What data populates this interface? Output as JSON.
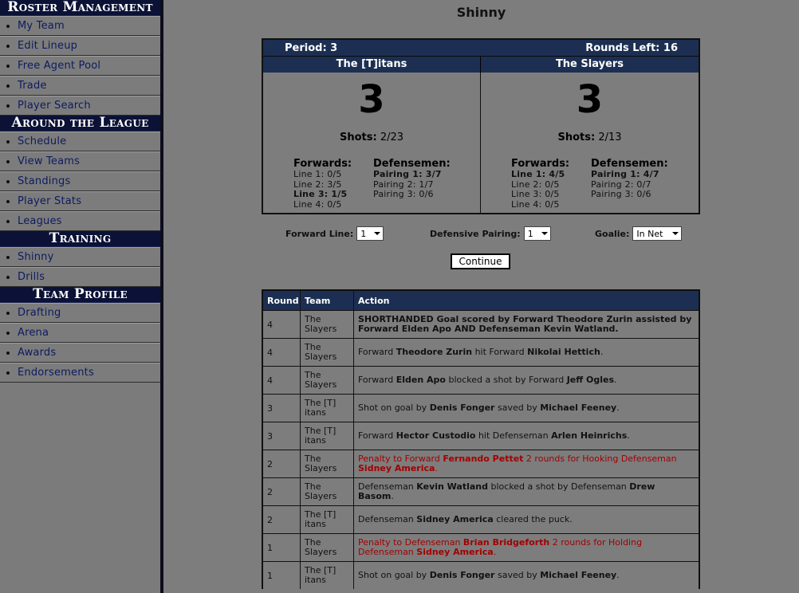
{
  "sidebar": {
    "sections": [
      {
        "title": "Roster Management",
        "items": [
          "My Team",
          "Edit Lineup",
          "Free Agent Pool",
          "Trade",
          "Player Search"
        ]
      },
      {
        "title": "Around the League",
        "items": [
          "Schedule",
          "View Teams",
          "Standings",
          "Player Stats",
          "Leagues"
        ]
      },
      {
        "title": "Training",
        "items": [
          "Shinny",
          "Drills"
        ]
      },
      {
        "title": "Team Profile",
        "items": [
          "Drafting",
          "Arena",
          "Awards",
          "Endorsements"
        ]
      }
    ]
  },
  "page": {
    "title": "Shinny"
  },
  "game": {
    "period_label": "Period: 3",
    "rounds_left_label": "Rounds Left: 16",
    "home": {
      "name": "The [T]itans",
      "score": "3",
      "shots_label": "Shots:",
      "shots_value": "2/23",
      "forwards_title": "Forwards:",
      "forwards": [
        {
          "text": "Line 1: 0/5",
          "bold": false
        },
        {
          "text": "Line 2: 3/5",
          "bold": false
        },
        {
          "text": "Line 3: 1/5",
          "bold": true
        },
        {
          "text": "Line 4: 0/5",
          "bold": false
        }
      ],
      "defense_title": "Defensemen:",
      "defense": [
        {
          "text": "Pairing 1: 3/7",
          "bold": true
        },
        {
          "text": "Pairing 2: 1/7",
          "bold": false
        },
        {
          "text": "Pairing 3: 0/6",
          "bold": false
        }
      ]
    },
    "away": {
      "name": "The Slayers",
      "score": "3",
      "shots_label": "Shots:",
      "shots_value": "2/13",
      "forwards_title": "Forwards:",
      "forwards": [
        {
          "text": "Line 1: 4/5",
          "bold": true
        },
        {
          "text": "Line 2: 0/5",
          "bold": false
        },
        {
          "text": "Line 3: 0/5",
          "bold": false
        },
        {
          "text": "Line 4: 0/5",
          "bold": false
        }
      ],
      "defense_title": "Defensemen:",
      "defense": [
        {
          "text": "Pairing 1: 4/7",
          "bold": true
        },
        {
          "text": "Pairing 2: 0/7",
          "bold": false
        },
        {
          "text": "Pairing 3: 0/6",
          "bold": false
        }
      ]
    }
  },
  "controls": {
    "forward_line_label": "Forward Line:",
    "forward_line_value": "1",
    "defensive_pairing_label": "Defensive Pairing:",
    "defensive_pairing_value": "1",
    "goalie_label": "Goalie:",
    "goalie_value": "In Net",
    "continue_label": "Continue"
  },
  "log": {
    "headers": [
      "Round",
      "Team",
      "Action"
    ],
    "rows": [
      {
        "round": "4",
        "team": [
          "The",
          "Slayers"
        ],
        "red": false,
        "segments": [
          {
            "t": "SHORTHANDED Goal scored by Forward Theodore Zurin assisted by Forward Elden Apo AND Defenseman Kevin Watland.",
            "b": true
          }
        ]
      },
      {
        "round": "4",
        "team": [
          "The",
          "Slayers"
        ],
        "red": false,
        "segments": [
          {
            "t": "Forward ",
            "b": false
          },
          {
            "t": "Theodore Zurin",
            "b": true
          },
          {
            "t": " hit Forward ",
            "b": false
          },
          {
            "t": "Nikolai Hettich",
            "b": true
          },
          {
            "t": ".",
            "b": false
          }
        ]
      },
      {
        "round": "4",
        "team": [
          "The",
          "Slayers"
        ],
        "red": false,
        "segments": [
          {
            "t": "Forward ",
            "b": false
          },
          {
            "t": "Elden Apo",
            "b": true
          },
          {
            "t": " blocked a shot by Forward ",
            "b": false
          },
          {
            "t": "Jeff Ogles",
            "b": true
          },
          {
            "t": ".",
            "b": false
          }
        ]
      },
      {
        "round": "3",
        "team": [
          "The [T]",
          "itans"
        ],
        "red": false,
        "segments": [
          {
            "t": "Shot on goal by ",
            "b": false
          },
          {
            "t": "Denis Fonger",
            "b": true
          },
          {
            "t": " saved by ",
            "b": false
          },
          {
            "t": "Michael Feeney",
            "b": true
          },
          {
            "t": ".",
            "b": false
          }
        ]
      },
      {
        "round": "3",
        "team": [
          "The [T]",
          "itans"
        ],
        "red": false,
        "segments": [
          {
            "t": "Forward ",
            "b": false
          },
          {
            "t": "Hector Custodio",
            "b": true
          },
          {
            "t": " hit Defenseman ",
            "b": false
          },
          {
            "t": "Arlen Heinrichs",
            "b": true
          },
          {
            "t": ".",
            "b": false
          }
        ]
      },
      {
        "round": "2",
        "team": [
          "The",
          "Slayers"
        ],
        "red": true,
        "segments": [
          {
            "t": "Penalty to Forward ",
            "b": false
          },
          {
            "t": "Fernando Pettet",
            "b": true
          },
          {
            "t": " 2 rounds for Hooking Defenseman ",
            "b": false
          },
          {
            "t": "Sidney America",
            "b": true
          },
          {
            "t": ".",
            "b": false
          }
        ]
      },
      {
        "round": "2",
        "team": [
          "The",
          "Slayers"
        ],
        "red": false,
        "segments": [
          {
            "t": "Defenseman ",
            "b": false
          },
          {
            "t": "Kevin Watland",
            "b": true
          },
          {
            "t": " blocked a shot by Defenseman ",
            "b": false
          },
          {
            "t": "Drew Basom",
            "b": true
          },
          {
            "t": ".",
            "b": false
          }
        ]
      },
      {
        "round": "2",
        "team": [
          "The [T]",
          "itans"
        ],
        "red": false,
        "segments": [
          {
            "t": "Defenseman ",
            "b": false
          },
          {
            "t": "Sidney America",
            "b": true
          },
          {
            "t": " cleared the puck.",
            "b": false
          }
        ]
      },
      {
        "round": "1",
        "team": [
          "The",
          "Slayers"
        ],
        "red": true,
        "segments": [
          {
            "t": "Penalty to Defenseman ",
            "b": false
          },
          {
            "t": "Brian Bridgeforth",
            "b": true
          },
          {
            "t": " 2 rounds for Holding Defenseman ",
            "b": false
          },
          {
            "t": "Sidney America",
            "b": true
          },
          {
            "t": ".",
            "b": false
          }
        ]
      },
      {
        "round": "1",
        "team": [
          "The [T]",
          "itans"
        ],
        "red": false,
        "segments": [
          {
            "t": "Shot on goal by ",
            "b": false
          },
          {
            "t": "Denis Fonger",
            "b": true
          },
          {
            "t": " saved by ",
            "b": false
          },
          {
            "t": "Michael Feeney",
            "b": true
          },
          {
            "t": ".",
            "b": false
          }
        ]
      }
    ]
  },
  "colors": {
    "header_bg": "#1c2f52",
    "sidebar_head_bg": "#0b1236",
    "page_bg": "#7d7d7d",
    "penalty_text": "#a30000",
    "link_text": "#0d1b60"
  }
}
